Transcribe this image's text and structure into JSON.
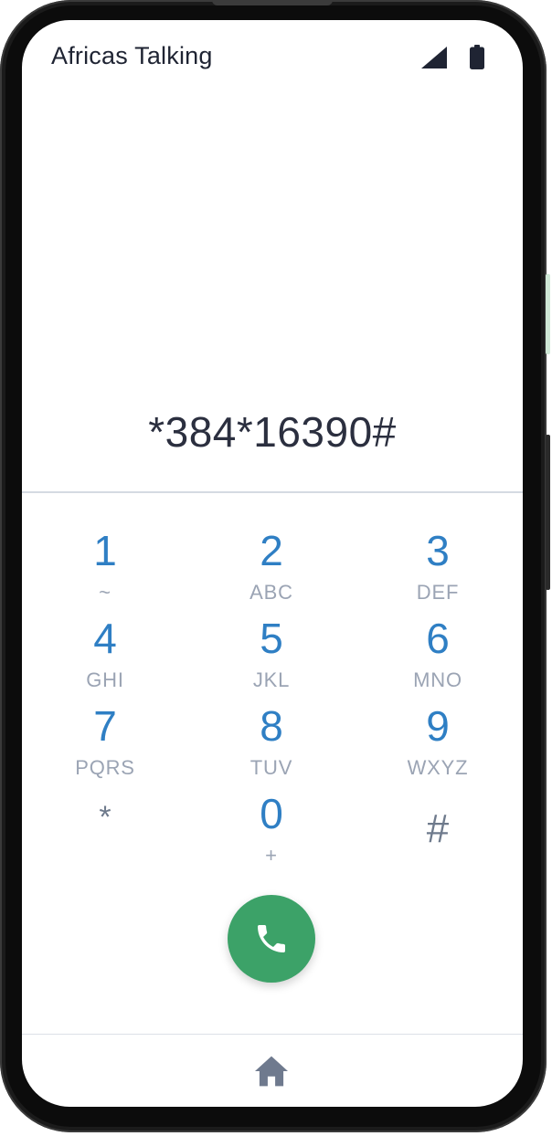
{
  "app": {
    "title": "Africas Talking"
  },
  "status_bar": {
    "icons": [
      "signal-icon",
      "battery-icon"
    ]
  },
  "dialer": {
    "display_value": "*384*16390#"
  },
  "keypad": {
    "keys": [
      {
        "digit": "1",
        "letters": "~"
      },
      {
        "digit": "2",
        "letters": "ABC"
      },
      {
        "digit": "3",
        "letters": "DEF"
      },
      {
        "digit": "4",
        "letters": "GHI"
      },
      {
        "digit": "5",
        "letters": "JKL"
      },
      {
        "digit": "6",
        "letters": "MNO"
      },
      {
        "digit": "7",
        "letters": "PQRS"
      },
      {
        "digit": "8",
        "letters": "TUV"
      },
      {
        "digit": "9",
        "letters": "WXYZ"
      },
      {
        "digit": "*",
        "letters": ""
      },
      {
        "digit": "0",
        "letters": "+"
      },
      {
        "digit": "#",
        "letters": ""
      }
    ]
  },
  "actions": {
    "call_icon": "phone-icon",
    "home_icon": "home-icon"
  },
  "colors": {
    "digit": "#2f7fc4",
    "letters": "#9ba4b4",
    "symbol": "#6e7a8c",
    "call_button": "#3ca268",
    "display_text": "#2b2f3f"
  }
}
